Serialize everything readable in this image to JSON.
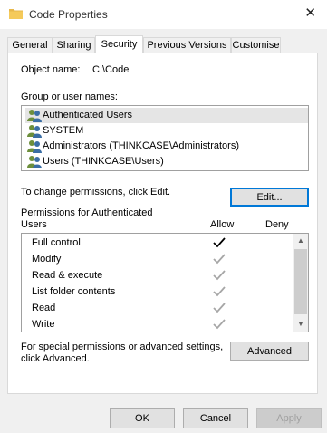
{
  "window": {
    "title": "Code Properties",
    "close_glyph": "✕",
    "icon": "folder-icon"
  },
  "tabs": [
    "General",
    "Sharing",
    "Security",
    "Previous Versions",
    "Customise"
  ],
  "active_tab": "Security",
  "object_name": {
    "label": "Object name:",
    "value": "C:\\Code"
  },
  "group_label": "Group or user names:",
  "users": [
    "Authenticated Users",
    "SYSTEM",
    "Administrators (THINKCASE\\Administrators)",
    "Users (THINKCASE\\Users)"
  ],
  "selected_user_index": 0,
  "change_permissions_text": "To change permissions, click Edit.",
  "edit_button": "Edit...",
  "permissions": {
    "label_line1": "Permissions for Authenticated",
    "label_line2": "Users",
    "allow_header": "Allow",
    "deny_header": "Deny",
    "rows": [
      {
        "name": "Full control",
        "allow": "explicit"
      },
      {
        "name": "Modify",
        "allow": "inherited"
      },
      {
        "name": "Read & execute",
        "allow": "inherited"
      },
      {
        "name": "List folder contents",
        "allow": "inherited"
      },
      {
        "name": "Read",
        "allow": "inherited"
      },
      {
        "name": "Write",
        "allow": "inherited"
      }
    ]
  },
  "special_text_line1": "For special permissions or advanced settings,",
  "special_text_line2": "click Advanced.",
  "advanced_button": "Advanced",
  "footer": {
    "ok": "OK",
    "cancel": "Cancel",
    "apply": "Apply"
  },
  "colors": {
    "explicit_check": "#000000",
    "inherited_check": "#a6a6a6",
    "focus": "#0078d7"
  }
}
